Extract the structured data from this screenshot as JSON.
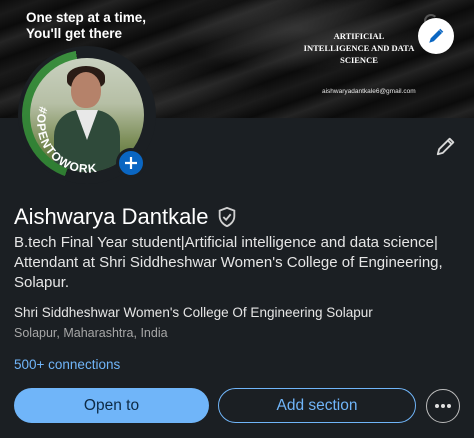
{
  "banner": {
    "tagline": "One step at a time,\nYou'll get there",
    "title": "ARTIFICIAL INTELLIGENCE AND DATA SCIENCE",
    "email": "aishwaryadantkale6@gmail.com"
  },
  "avatar": {
    "badge_text": "#OPENTOWORK"
  },
  "profile": {
    "name": "Aishwarya Dantkale",
    "headline": "B.tech Final Year student|Artificial intelligence and data science| Attendant at Shri Siddheshwar Women's College of Engineering, Solapur.",
    "education": "Shri Siddheshwar Women's College Of Engineering Solapur",
    "location": "Solapur, Maharashtra, India",
    "connections": "500+ connections"
  },
  "actions": {
    "open_to": "Open to",
    "add_section": "Add section"
  },
  "colors": {
    "background": "#1b1f23",
    "accent": "#70b5f9",
    "brand_blue": "#0a66c2",
    "otw_green": "#3b8f3e"
  }
}
